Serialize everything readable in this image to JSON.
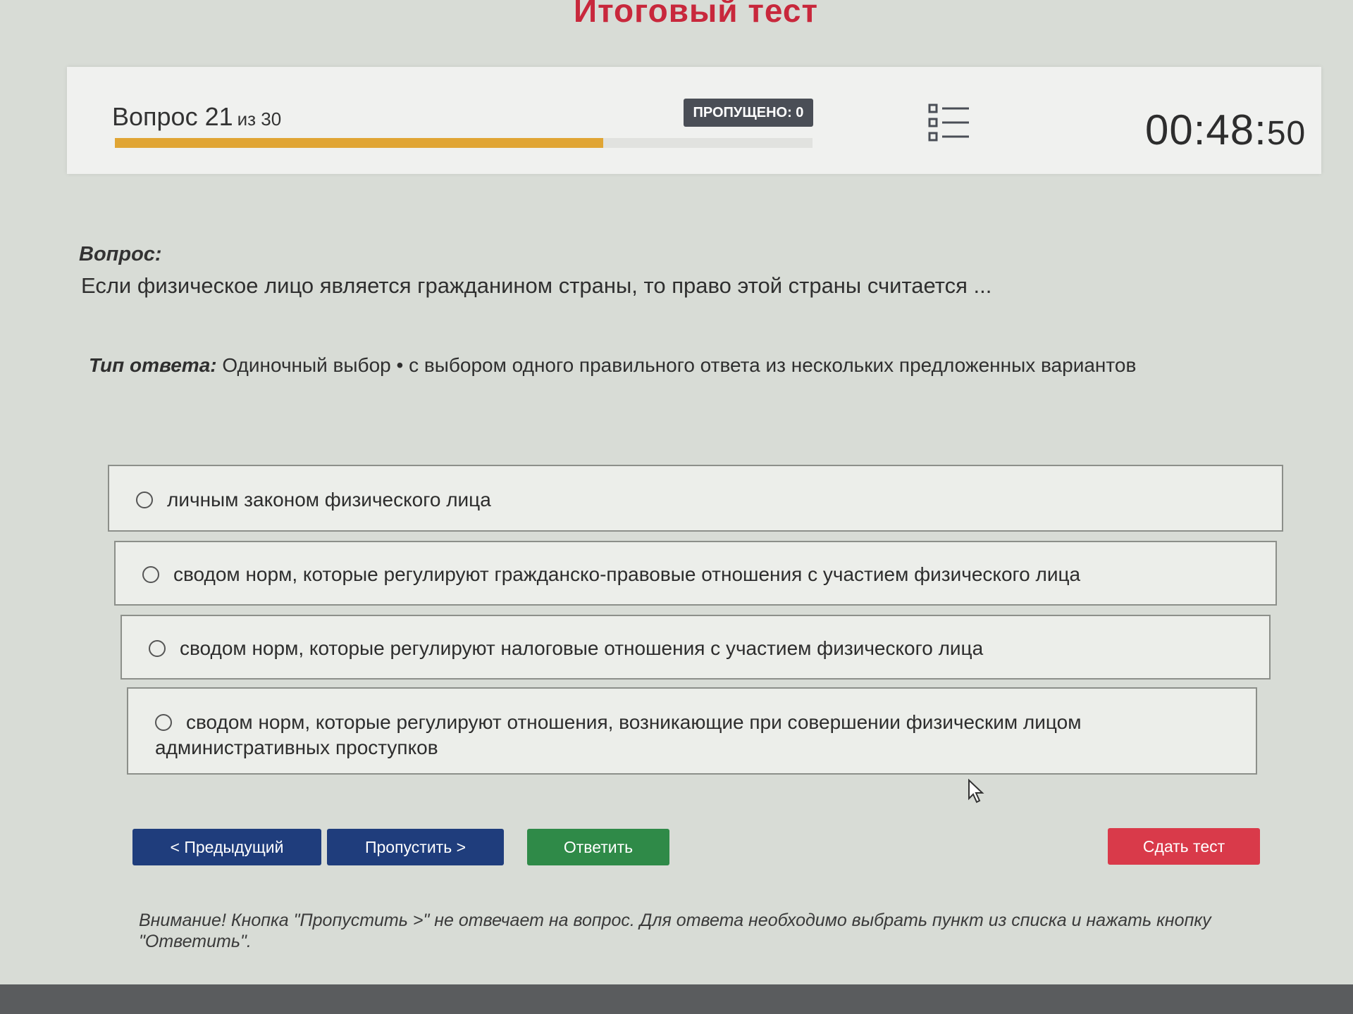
{
  "page": {
    "title": "Итоговый тест"
  },
  "status": {
    "question_label": "Вопрос 21",
    "question_total": "из 30",
    "progress": 0.7,
    "skipped": "ПРОПУЩЕНО: 0",
    "timer_main": "00:48:",
    "timer_seconds": "50"
  },
  "question": {
    "label": "Вопрос:",
    "text": "Если физическое лицо является гражданином страны, то право этой страны считается ..."
  },
  "answer_type": {
    "label": "Тип ответа:",
    "value": "Одиночный выбор • с выбором одного правильного ответа из нескольких предложенных вариантов"
  },
  "options": [
    {
      "label": "личным законом физического лица"
    },
    {
      "label": "сводом норм, которые регулируют гражданско-правовые отношения с участием физического лица"
    },
    {
      "label": "сводом норм, которые регулируют налоговые отношения с участием физического лица"
    },
    {
      "label": "сводом норм, которые регулируют отношения, возникающие при совершении физическим лицом административных проступков"
    }
  ],
  "buttons": {
    "prev": "< Предыдущий",
    "skip": "Пропустить >",
    "answer": "Ответить",
    "submit": "Сдать тест"
  },
  "notice": "Внимание! Кнопка \"Пропустить >\" не отвечает на вопрос. Для ответа необходимо выбрать пункт из списка и нажать кнопку \"Ответить\".",
  "colors": {
    "accent": "#c8283c",
    "progress": "#e0a534",
    "nav_button": "#1f3d7c",
    "answer_button": "#2f8a48",
    "submit_button": "#d93a4a"
  },
  "icons": {
    "question_list": "list-icon",
    "pointer": "cursor-icon"
  }
}
